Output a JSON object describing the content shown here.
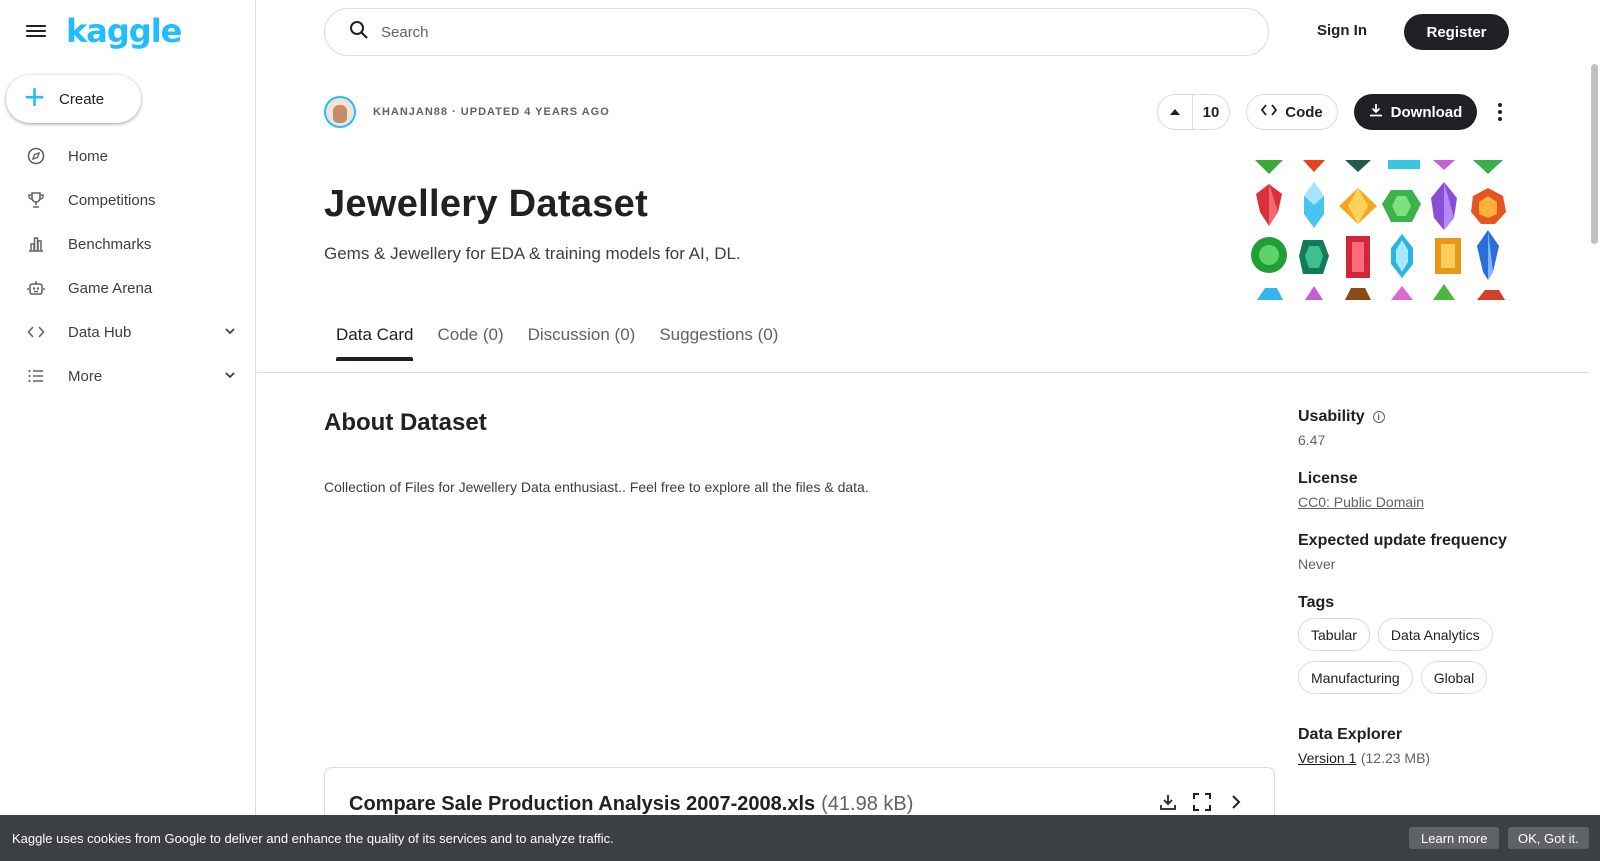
{
  "brand": {
    "logo_text": "kaggle",
    "accent_color": "#20beff"
  },
  "sidebar": {
    "menu_icon": "menu-icon",
    "create_label": "Create",
    "items": [
      {
        "label": "Home",
        "icon": "compass-icon"
      },
      {
        "label": "Competitions",
        "icon": "trophy-icon"
      },
      {
        "label": "Benchmarks",
        "icon": "bar-chart-icon"
      },
      {
        "label": "Game Arena",
        "icon": "robot-icon"
      },
      {
        "label": "Data Hub",
        "icon": "code-icon",
        "expandable": true
      },
      {
        "label": "More",
        "icon": "list-icon",
        "expandable": true
      }
    ]
  },
  "header": {
    "search_placeholder": "Search",
    "sign_in": "Sign In",
    "register": "Register"
  },
  "dataset": {
    "author_meta": "KHANJAN88 · UPDATED 4 YEARS AGO",
    "upvotes": "10",
    "code_label": "Code",
    "download_label": "Download",
    "title": "Jewellery Dataset",
    "subtitle": "Gems & Jewellery for EDA & training models for AI, DL."
  },
  "tabs": [
    {
      "label": "Data Card",
      "active": true
    },
    {
      "label": "Code (0)",
      "active": false
    },
    {
      "label": "Discussion (0)",
      "active": false
    },
    {
      "label": "Suggestions (0)",
      "active": false
    }
  ],
  "about": {
    "heading": "About Dataset",
    "description": "Collection of Files for Jewellery Data enthusiast.. Feel free to explore all the files & data."
  },
  "side_panel": {
    "usability_label": "Usability",
    "usability_value": "6.47",
    "license_label": "License",
    "license_value": "CC0: Public Domain",
    "frequency_label": "Expected update frequency",
    "frequency_value": "Never",
    "tags_label": "Tags",
    "tags": [
      "Tabular",
      "Data Analytics",
      "Manufacturing",
      "Global"
    ],
    "explorer_label": "Data Explorer",
    "version_label": "Version 1",
    "version_size": "(12.23 MB)"
  },
  "file": {
    "name": "Compare Sale Production Analysis 2007-2008.xls",
    "size": "(41.98 kB)"
  },
  "cookie": {
    "text": "Kaggle uses cookies from Google to deliver and enhance the quality of its services and to analyze traffic.",
    "learn_more": "Learn more",
    "ok": "OK, Got it."
  }
}
